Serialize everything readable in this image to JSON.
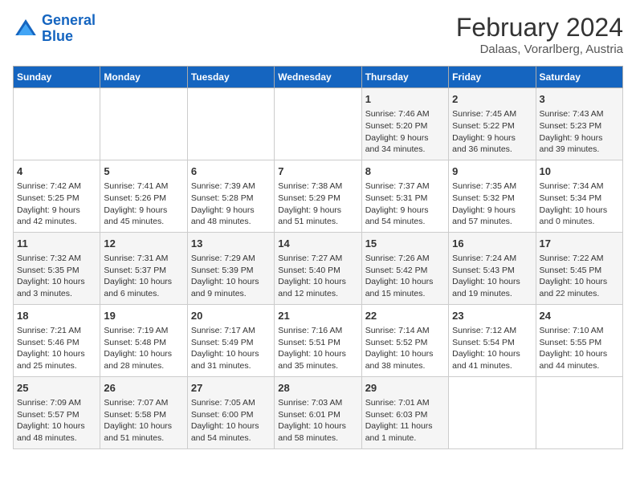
{
  "header": {
    "logo_line1": "General",
    "logo_line2": "Blue",
    "title": "February 2024",
    "subtitle": "Dalaas, Vorarlberg, Austria"
  },
  "weekdays": [
    "Sunday",
    "Monday",
    "Tuesday",
    "Wednesday",
    "Thursday",
    "Friday",
    "Saturday"
  ],
  "weeks": [
    [
      {
        "day": "",
        "info": ""
      },
      {
        "day": "",
        "info": ""
      },
      {
        "day": "",
        "info": ""
      },
      {
        "day": "",
        "info": ""
      },
      {
        "day": "1",
        "info": "Sunrise: 7:46 AM\nSunset: 5:20 PM\nDaylight: 9 hours\nand 34 minutes."
      },
      {
        "day": "2",
        "info": "Sunrise: 7:45 AM\nSunset: 5:22 PM\nDaylight: 9 hours\nand 36 minutes."
      },
      {
        "day": "3",
        "info": "Sunrise: 7:43 AM\nSunset: 5:23 PM\nDaylight: 9 hours\nand 39 minutes."
      }
    ],
    [
      {
        "day": "4",
        "info": "Sunrise: 7:42 AM\nSunset: 5:25 PM\nDaylight: 9 hours\nand 42 minutes."
      },
      {
        "day": "5",
        "info": "Sunrise: 7:41 AM\nSunset: 5:26 PM\nDaylight: 9 hours\nand 45 minutes."
      },
      {
        "day": "6",
        "info": "Sunrise: 7:39 AM\nSunset: 5:28 PM\nDaylight: 9 hours\nand 48 minutes."
      },
      {
        "day": "7",
        "info": "Sunrise: 7:38 AM\nSunset: 5:29 PM\nDaylight: 9 hours\nand 51 minutes."
      },
      {
        "day": "8",
        "info": "Sunrise: 7:37 AM\nSunset: 5:31 PM\nDaylight: 9 hours\nand 54 minutes."
      },
      {
        "day": "9",
        "info": "Sunrise: 7:35 AM\nSunset: 5:32 PM\nDaylight: 9 hours\nand 57 minutes."
      },
      {
        "day": "10",
        "info": "Sunrise: 7:34 AM\nSunset: 5:34 PM\nDaylight: 10 hours\nand 0 minutes."
      }
    ],
    [
      {
        "day": "11",
        "info": "Sunrise: 7:32 AM\nSunset: 5:35 PM\nDaylight: 10 hours\nand 3 minutes."
      },
      {
        "day": "12",
        "info": "Sunrise: 7:31 AM\nSunset: 5:37 PM\nDaylight: 10 hours\nand 6 minutes."
      },
      {
        "day": "13",
        "info": "Sunrise: 7:29 AM\nSunset: 5:39 PM\nDaylight: 10 hours\nand 9 minutes."
      },
      {
        "day": "14",
        "info": "Sunrise: 7:27 AM\nSunset: 5:40 PM\nDaylight: 10 hours\nand 12 minutes."
      },
      {
        "day": "15",
        "info": "Sunrise: 7:26 AM\nSunset: 5:42 PM\nDaylight: 10 hours\nand 15 minutes."
      },
      {
        "day": "16",
        "info": "Sunrise: 7:24 AM\nSunset: 5:43 PM\nDaylight: 10 hours\nand 19 minutes."
      },
      {
        "day": "17",
        "info": "Sunrise: 7:22 AM\nSunset: 5:45 PM\nDaylight: 10 hours\nand 22 minutes."
      }
    ],
    [
      {
        "day": "18",
        "info": "Sunrise: 7:21 AM\nSunset: 5:46 PM\nDaylight: 10 hours\nand 25 minutes."
      },
      {
        "day": "19",
        "info": "Sunrise: 7:19 AM\nSunset: 5:48 PM\nDaylight: 10 hours\nand 28 minutes."
      },
      {
        "day": "20",
        "info": "Sunrise: 7:17 AM\nSunset: 5:49 PM\nDaylight: 10 hours\nand 31 minutes."
      },
      {
        "day": "21",
        "info": "Sunrise: 7:16 AM\nSunset: 5:51 PM\nDaylight: 10 hours\nand 35 minutes."
      },
      {
        "day": "22",
        "info": "Sunrise: 7:14 AM\nSunset: 5:52 PM\nDaylight: 10 hours\nand 38 minutes."
      },
      {
        "day": "23",
        "info": "Sunrise: 7:12 AM\nSunset: 5:54 PM\nDaylight: 10 hours\nand 41 minutes."
      },
      {
        "day": "24",
        "info": "Sunrise: 7:10 AM\nSunset: 5:55 PM\nDaylight: 10 hours\nand 44 minutes."
      }
    ],
    [
      {
        "day": "25",
        "info": "Sunrise: 7:09 AM\nSunset: 5:57 PM\nDaylight: 10 hours\nand 48 minutes."
      },
      {
        "day": "26",
        "info": "Sunrise: 7:07 AM\nSunset: 5:58 PM\nDaylight: 10 hours\nand 51 minutes."
      },
      {
        "day": "27",
        "info": "Sunrise: 7:05 AM\nSunset: 6:00 PM\nDaylight: 10 hours\nand 54 minutes."
      },
      {
        "day": "28",
        "info": "Sunrise: 7:03 AM\nSunset: 6:01 PM\nDaylight: 10 hours\nand 58 minutes."
      },
      {
        "day": "29",
        "info": "Sunrise: 7:01 AM\nSunset: 6:03 PM\nDaylight: 11 hours\nand 1 minute."
      },
      {
        "day": "",
        "info": ""
      },
      {
        "day": "",
        "info": ""
      }
    ]
  ]
}
